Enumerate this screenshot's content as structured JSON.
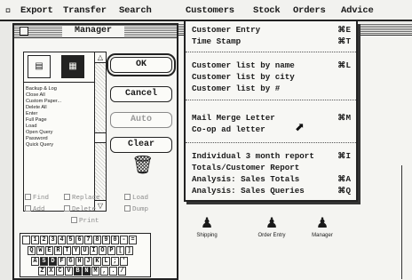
{
  "menubar": {
    "apple_icon": "apple-icon",
    "items": [
      "Export",
      "Transfer",
      "Search",
      "Customers",
      "Stock",
      "Orders",
      "Advice"
    ]
  },
  "customers_menu": {
    "groups": [
      [
        {
          "label": "Customer Entry",
          "shortcut": "⌘E"
        },
        {
          "label": "Time Stamp",
          "shortcut": "⌘T"
        }
      ],
      [
        {
          "label": "Customer list by name",
          "shortcut": "⌘L"
        },
        {
          "label": "Customer list by city",
          "shortcut": ""
        },
        {
          "label": "Customer list by #",
          "shortcut": ""
        }
      ],
      [
        {
          "label": "Mail Merge Letter",
          "shortcut": "⌘M"
        },
        {
          "label": "Co-op ad letter",
          "shortcut": ""
        }
      ],
      [
        {
          "label": "Individual 3 month report",
          "shortcut": "⌘I"
        },
        {
          "label": "Totals/Customer Report",
          "shortcut": ""
        },
        {
          "label": "Analysis: Sales Totals",
          "shortcut": "⌘A"
        },
        {
          "label": "Analysis: Sales Queries",
          "shortcut": "⌘Q"
        }
      ]
    ]
  },
  "background_window": {
    "icons": [
      {
        "label": "Shipping",
        "icon": "person-desk-icon"
      },
      {
        "label": "Order Entry",
        "icon": "person-desk-icon"
      },
      {
        "label": "Manager",
        "icon": "person-desk-icon"
      }
    ]
  },
  "manager_dialog": {
    "title": "Manager",
    "list_items": [
      "Backup & Log",
      "Close All",
      "Custom Paper...",
      "Delete All",
      "Enter",
      "Full Page",
      "Load",
      "Open Query",
      "Password",
      "Quick Query"
    ],
    "buttons": {
      "ok": "OK",
      "cancel": "Cancel",
      "auto": "Auto",
      "clear": "Clear"
    },
    "checkboxes": [
      {
        "label": "Find",
        "enabled": false
      },
      {
        "label": "Replace",
        "enabled": false
      },
      {
        "label": "Load",
        "enabled": false
      },
      {
        "label": "Add",
        "enabled": false
      },
      {
        "label": "Delete",
        "enabled": false
      },
      {
        "label": "Dump",
        "enabled": false
      },
      {
        "label": "Print",
        "enabled": false
      }
    ],
    "keyboard_rows": [
      [
        "`",
        "1",
        "2",
        "3",
        "4",
        "5",
        "6",
        "7",
        "8",
        "9",
        "0",
        "-",
        "="
      ],
      [
        "Q",
        "W",
        "E",
        "R",
        "T",
        "Y",
        "U",
        "I",
        "O",
        "P",
        "[",
        "]"
      ],
      [
        "A",
        "S",
        "D",
        "F",
        "G",
        "H",
        "J",
        "K",
        "L",
        ";",
        "'"
      ],
      [
        "Z",
        "X",
        "C",
        "V",
        "B",
        "N",
        "M",
        ",",
        ".",
        "/"
      ]
    ]
  }
}
